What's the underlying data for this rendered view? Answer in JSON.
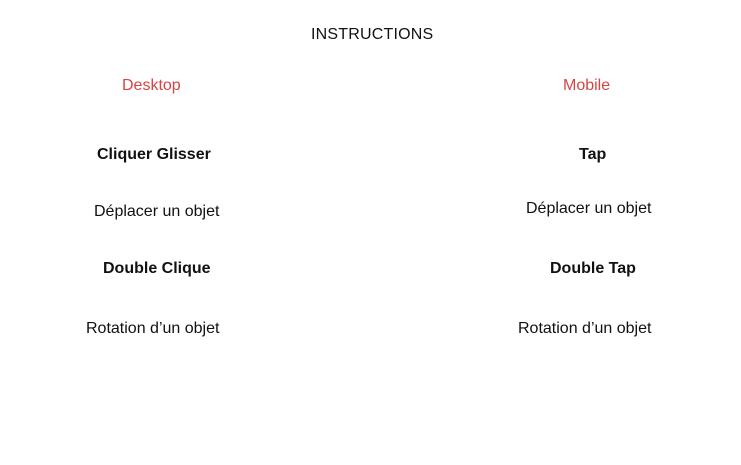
{
  "title": "INSTRUCTIONS",
  "colors": {
    "heading": "#d64545",
    "text": "#111111",
    "background": "#ffffff"
  },
  "desktop": {
    "heading": "Desktop",
    "items": [
      {
        "action": "Cliquer Glisser",
        "description": "Déplacer un objet"
      },
      {
        "action": "Double Clique",
        "description": "Rotation d’un objet"
      }
    ]
  },
  "mobile": {
    "heading": "Mobile",
    "items": [
      {
        "action": "Tap",
        "description": "Déplacer un objet"
      },
      {
        "action": "Double Tap",
        "description": "Rotation d’un objet"
      }
    ]
  }
}
